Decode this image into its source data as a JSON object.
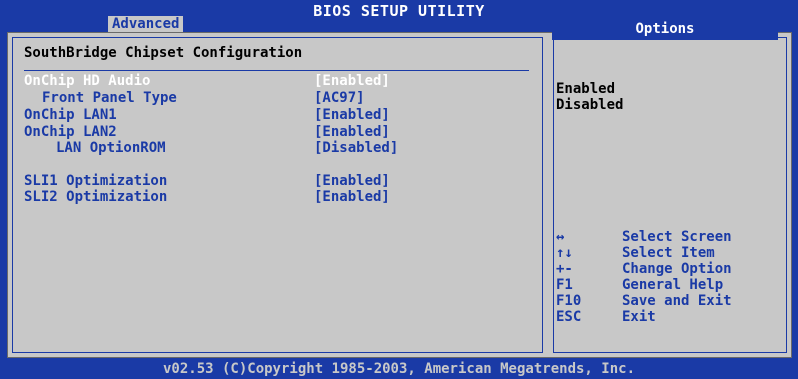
{
  "header": {
    "title": "BIOS SETUP UTILITY",
    "active_tab": "Advanced"
  },
  "main": {
    "section_title": "SouthBridge Chipset Configuration",
    "items": [
      {
        "label": "OnChip HD Audio",
        "value": "[Enabled]"
      },
      {
        "label": "Front Panel Type",
        "value": "[AC97]"
      },
      {
        "label": "OnChip LAN1",
        "value": "[Enabled]"
      },
      {
        "label": "OnChip LAN2",
        "value": "[Enabled]"
      },
      {
        "label": "LAN OptionROM",
        "value": "[Disabled]"
      },
      {
        "label": "SLI1 Optimization",
        "value": "[Enabled]"
      },
      {
        "label": "SLI2 Optimization",
        "value": "[Enabled]"
      }
    ]
  },
  "options": {
    "heading": "Options",
    "choices": [
      "Enabled",
      "Disabled"
    ]
  },
  "help": [
    {
      "key": "↔",
      "desc": "Select Screen"
    },
    {
      "key": "↑↓",
      "desc": "Select Item"
    },
    {
      "key": "+-",
      "desc": "Change Option"
    },
    {
      "key": "F1",
      "desc": "General Help"
    },
    {
      "key": "F10",
      "desc": "Save and Exit"
    },
    {
      "key": "ESC",
      "desc": "Exit"
    }
  ],
  "footer": {
    "text": "v02.53 (C)Copyright 1985-2003, American Megatrends, Inc."
  }
}
